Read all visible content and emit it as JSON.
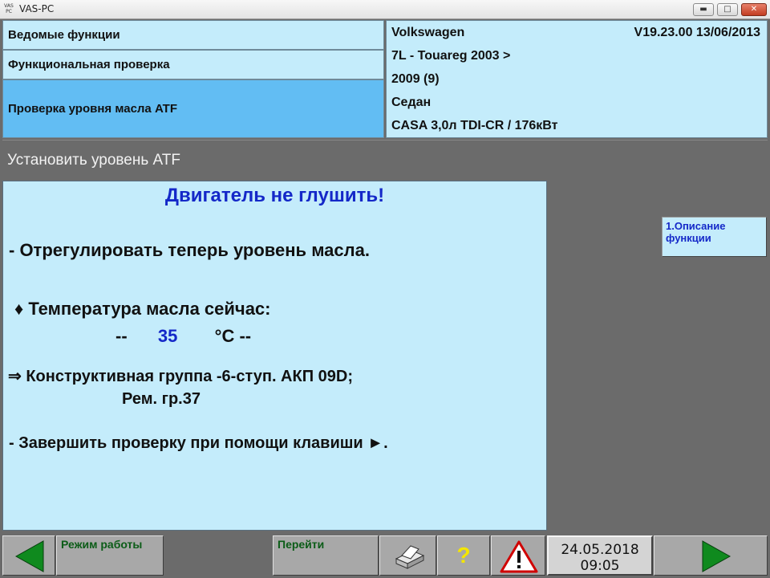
{
  "window": {
    "logo_text": "VAS PC",
    "title": "VAS-PC",
    "min_glyph": "▬",
    "max_glyph": "□",
    "close_glyph": "✕"
  },
  "header": {
    "path": [
      "Ведомые функции",
      "Функциональная проверка",
      "Проверка уровня масла ATF"
    ]
  },
  "vehicle": {
    "brand": "Volkswagen",
    "version": "V19.23.00 13/06/2013",
    "model": "7L - Touareg 2003 >",
    "year": "2009 (9)",
    "body": "Седан",
    "engine": "CASA 3,0л TDI-CR / 176кВт"
  },
  "section": {
    "title": "Установить уровень ATF"
  },
  "content": {
    "warning": "Двигатель не глушить!",
    "line1": "- Отрегулировать теперь уровень масла.",
    "temp_label": "♦ Температура масла сейчас:",
    "temp_prefix": "--",
    "temp_value": "35",
    "temp_suffix": "°C --",
    "group_line": "⇒ Конструктивная группа -6-ступ. АКП 09D;",
    "repair_group": "Рем. гр.37",
    "finish_line": "- Завершить проверку при помощи клавиши ►."
  },
  "side_button": {
    "label": "1.Описание функции"
  },
  "bottom": {
    "mode_label": "Режим работы",
    "go_label": "Перейти",
    "help_glyph": "?",
    "date": "24.05.2018",
    "time": "09:05"
  },
  "colors": {
    "light_panel": "#c4ecfb",
    "active_path": "#62bdf3",
    "accent_blue": "#1428c8",
    "nav_green": "#0f8a1e"
  },
  "icons": [
    "back-arrow-icon",
    "printer-icon",
    "help-icon",
    "warning-triangle-icon",
    "forward-arrow-icon"
  ]
}
